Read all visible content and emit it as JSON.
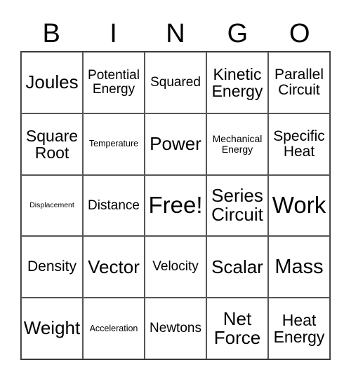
{
  "header": {
    "letters": [
      "B",
      "I",
      "N",
      "G",
      "O"
    ]
  },
  "grid": {
    "rows": [
      [
        "Joules",
        "Potential Energy",
        "Squared",
        "Kinetic Energy",
        "Parallel Circuit"
      ],
      [
        "Square Root",
        "Temperature",
        "Power",
        "Mechanical Energy",
        "Specific Heat"
      ],
      [
        "Displacement",
        "Distance",
        "Free!",
        "Series Circuit",
        "Work"
      ],
      [
        "Density",
        "Vector",
        "Velocity",
        "Scalar",
        "Mass"
      ],
      [
        "Weight",
        "Acceleration",
        "Newtons",
        "Net Force",
        "Heat Energy"
      ]
    ]
  }
}
